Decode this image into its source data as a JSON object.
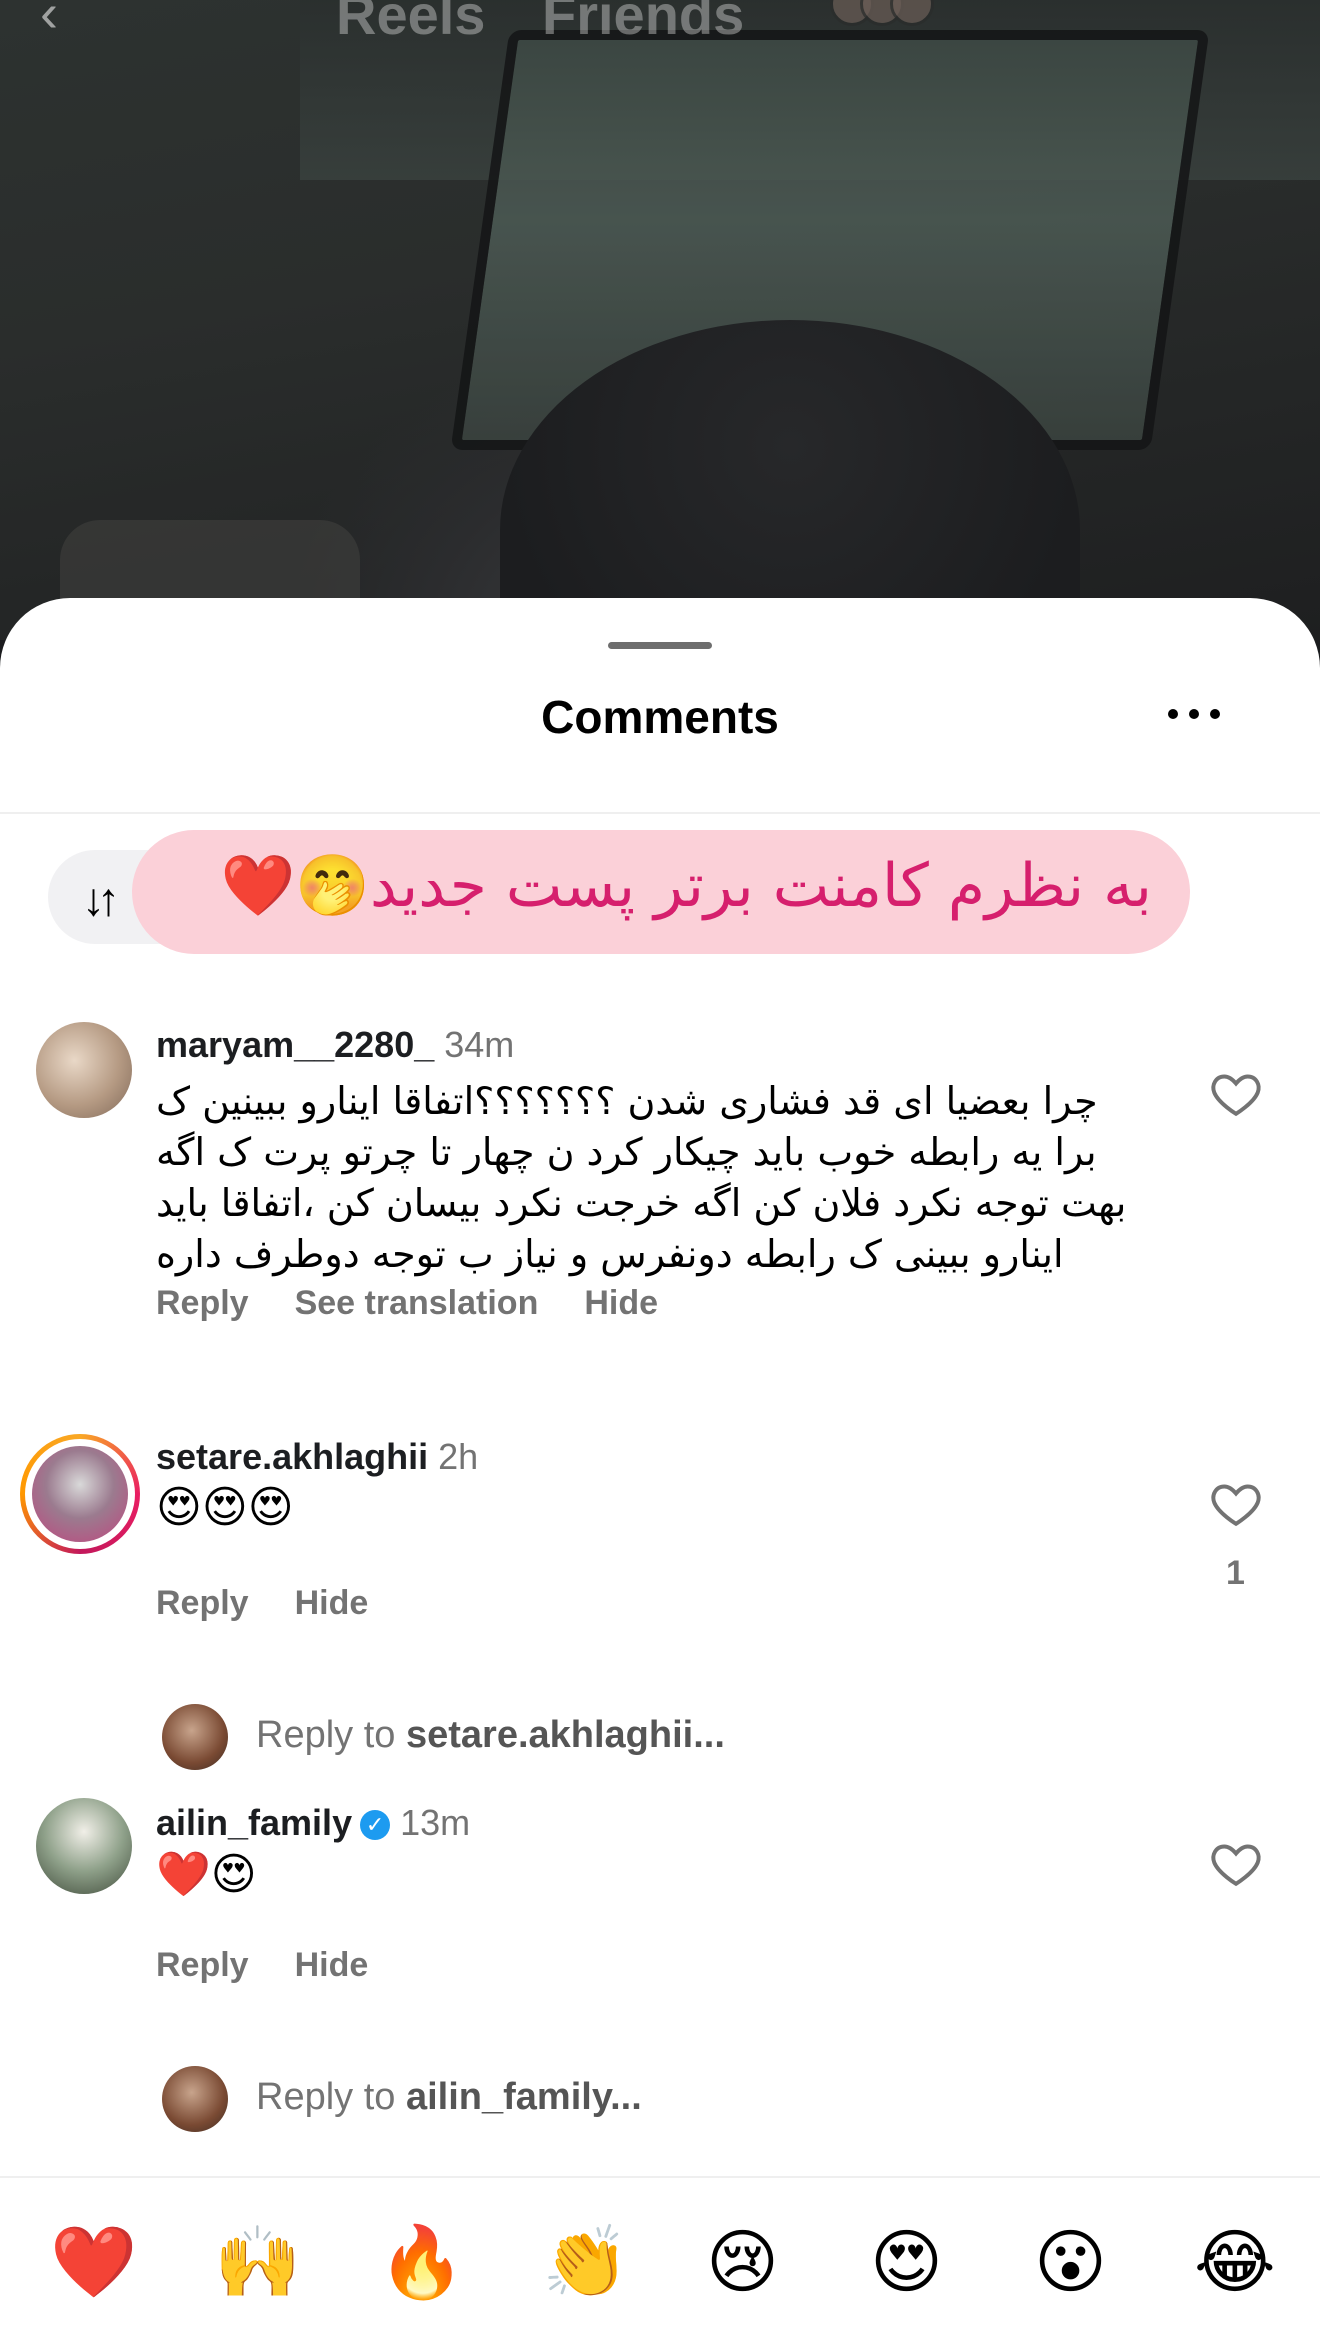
{
  "background": {
    "tabs": [
      "Reels",
      "Friends"
    ],
    "back_icon": "chevron-left-icon"
  },
  "sheet": {
    "title": "Comments",
    "more_icon": "more-horizontal-icon",
    "sort_icon": "sort-arrows-icon",
    "banner_text": "به نظرم کامنت برتر پست جدید🤭❤️"
  },
  "comments": [
    {
      "username": "maryam__2280_",
      "time": "34m",
      "text": "چرا بعضیا ای قد فشاری شدن ؟؟؟؟؟؟؟اتفاقا اینارو ببینین ک برا یه رابطه خوب باید چیکار کرد ن چهار تا چرتو پرت ک اگه بهت توجه نکرد فلان کن اگه خرجت نکرد بیسان کن ،اتفاقا باید اینارو ببینی ک رابطه دونفرس و نیاز ب توجه دوطرف داره",
      "actions": [
        "Reply",
        "See translation",
        "Hide"
      ]
    },
    {
      "username": "setare.akhlaghii",
      "time": "2h",
      "text": "😍😍😍",
      "actions": [
        "Reply",
        "Hide"
      ],
      "likes": "1",
      "reply_prefix": "Reply to ",
      "reply_target": "setare.akhlaghii..."
    },
    {
      "username": "ailin_family",
      "verified": true,
      "time": "13m",
      "text": "❤️😍",
      "actions": [
        "Reply",
        "Hide"
      ],
      "reply_prefix": "Reply to ",
      "reply_target": "ailin_family..."
    }
  ],
  "quick_reactions": [
    "❤️",
    "🙌",
    "🔥",
    "👏",
    "😢",
    "😍",
    "😮",
    "😂"
  ],
  "colors": {
    "banner_bg": "#fbd0d8",
    "banner_text": "#d61f6d",
    "verified": "#1d9bf0"
  }
}
